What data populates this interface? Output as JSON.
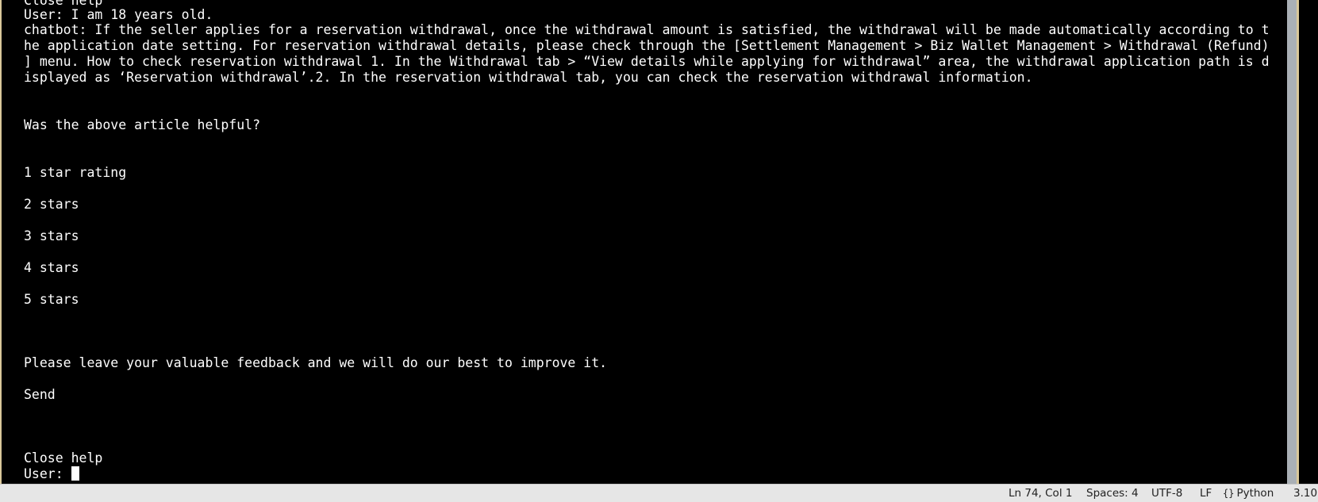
{
  "terminal": {
    "lines": [
      "Close help",
      "User: I am 18 years old.",
      "chatbot: If the seller applies for a reservation withdrawal, once the withdrawal amount is satisfied, the withdrawal will be made automatically according to t",
      "he application date setting. For reservation withdrawal details, please check through the [Settlement Management > Biz Wallet Management > Withdrawal (Refund)",
      "] menu. How to check reservation withdrawal 1. In the Withdrawal tab > “View details while applying for withdrawal” area, the withdrawal application path is d",
      "isplayed as ‘Reservation withdrawal’.2. In the reservation withdrawal tab, you can check the reservation withdrawal information.",
      "Was the above article helpful?",
      "1 star rating",
      "2 stars",
      "3 stars",
      "4 stars",
      "5 stars",
      "Please leave your valuable feedback and we will do our best to improve it.",
      "Send",
      "Close help",
      "User: "
    ]
  },
  "statusbar": {
    "position": "Ln 74, Col 1",
    "indentation": "Spaces: 4",
    "encoding": "UTF-8",
    "line_ending": "LF",
    "language_icon": "braces-icon",
    "language": "Python",
    "version": "3.10"
  },
  "colors": {
    "background": "#000000",
    "text": "#ffffff",
    "border": "#d9c79a",
    "statusbar": "#e6e6e6"
  }
}
